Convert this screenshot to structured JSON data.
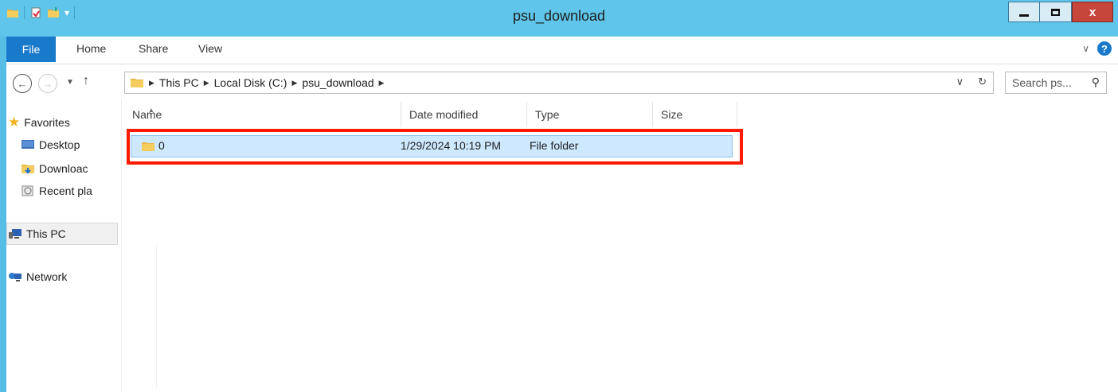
{
  "window": {
    "title": "psu_download",
    "close_label": "x"
  },
  "ribbon": {
    "tabs": [
      "File",
      "Home",
      "Share",
      "View"
    ],
    "help_label": "?"
  },
  "navigation": {
    "breadcrumbs": [
      "This PC",
      "Local Disk (C:)",
      "psu_download"
    ],
    "search_placeholder": "Search ps..."
  },
  "nav_pane": {
    "favorites": "Favorites",
    "items": [
      "Desktop",
      "Downloac",
      "Recent pla"
    ],
    "this_pc": "This PC",
    "network": "Network"
  },
  "file_list": {
    "columns": [
      "Name",
      "Date modified",
      "Type",
      "Size"
    ],
    "rows": [
      {
        "name": "0",
        "date_modified": "1/29/2024 10:19 PM",
        "type": "File folder",
        "size": ""
      }
    ]
  },
  "colors": {
    "title_bar": "#5fc5ea",
    "file_tab": "#1979ca",
    "selection": "#cde8ff",
    "highlight_border": "#ff1a00",
    "close_button": "#c7463c"
  },
  "icons": [
    "folder-icon",
    "properties-icon",
    "new-folder-icon",
    "back-icon",
    "forward-icon",
    "up-icon",
    "refresh-icon",
    "search-icon",
    "star-icon",
    "desktop-icon",
    "downloads-icon",
    "recent-places-icon",
    "computer-icon",
    "network-icon",
    "help-icon"
  ]
}
